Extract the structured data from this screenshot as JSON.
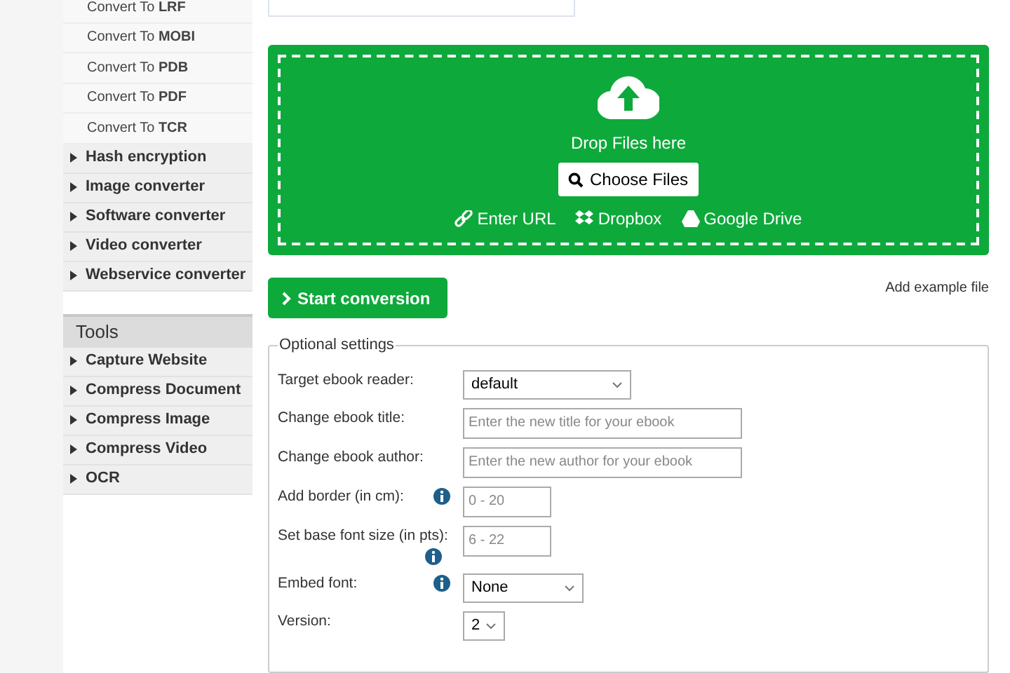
{
  "sidebar": {
    "sub_items": [
      {
        "label": "Convert To **LRF**"
      },
      {
        "label": "Convert To **MOBI**"
      },
      {
        "label": "Convert To **PDB**"
      },
      {
        "label": "Convert To **PDF**"
      },
      {
        "label": "Convert To **TCR**"
      }
    ],
    "categories": [
      {
        "label": "Hash encryption",
        "expanded": false
      },
      {
        "label": "Image converter",
        "expanded": false
      },
      {
        "label": "Software converter",
        "expanded": false
      },
      {
        "label": "Video converter",
        "expanded": false
      },
      {
        "label": "Webservice converter",
        "expanded": false
      }
    ],
    "tools": {
      "title": "Tools",
      "items": [
        {
          "label": "Capture Website",
          "expanded": false
        },
        {
          "label": "Compress Document",
          "expanded": false
        },
        {
          "label": "Compress Image",
          "expanded": false
        },
        {
          "label": "Compress Video",
          "expanded": false
        },
        {
          "label": "OCR",
          "expanded": false
        }
      ]
    }
  },
  "upload": {
    "drop_text": "Drop Files here",
    "choose_button": "Choose Files",
    "sources": [
      {
        "kind": "url",
        "label": "Enter URL"
      },
      {
        "kind": "dropbox",
        "label": "Dropbox"
      },
      {
        "kind": "drive",
        "label": "Google Drive"
      }
    ]
  },
  "start_button": "Start conversion",
  "example_link": "Add example file",
  "settings": {
    "title": "Optional settings",
    "rows": [
      {
        "kind": "wideselect",
        "label": "Target ebook reader:",
        "value": "default",
        "info": false
      },
      {
        "kind": "text",
        "label": "Change ebook title:",
        "placeholder": "Enter the new title for your ebook",
        "info": false
      },
      {
        "kind": "text",
        "label": "Change ebook author:",
        "placeholder": "Enter the new author for your ebook",
        "info": false
      },
      {
        "kind": "number",
        "label": "Add border (in cm):",
        "placeholder": "0 - 20",
        "info": true
      },
      {
        "kind": "number",
        "label": "Set base font size (in pts):",
        "placeholder": "6 - 22",
        "info": true
      },
      {
        "kind": "select",
        "label": "Embed font:",
        "value": "None",
        "info": true
      },
      {
        "kind": "tinyselect",
        "label": "Version:",
        "value": "2",
        "info": false
      }
    ]
  }
}
